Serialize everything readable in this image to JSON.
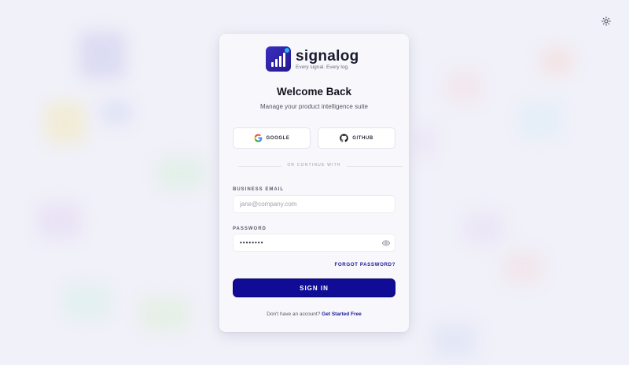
{
  "brand": {
    "name": "signalog",
    "tagline": "Every signal. Every log.",
    "accent": "#110c95"
  },
  "card": {
    "title": "Welcome Back",
    "subtitle": "Manage your product intelligence suite"
  },
  "social": {
    "google_label": "GOOGLE",
    "github_label": "GITHUB"
  },
  "divider_label": "OR CONTINUE WITH",
  "form": {
    "email_label": "BUSINESS EMAIL",
    "email_placeholder": "jane@company.com",
    "email_value": "",
    "password_label": "PASSWORD",
    "password_value": "••••••••",
    "forgot_label": "FORGOT PASSWORD?",
    "submit_label": "SIGN IN"
  },
  "footer": {
    "prompt": "Don't have an account?",
    "link": "Get Started Free"
  },
  "icons": {
    "theme_toggle": "sun-icon",
    "password_toggle": "eye-icon"
  }
}
